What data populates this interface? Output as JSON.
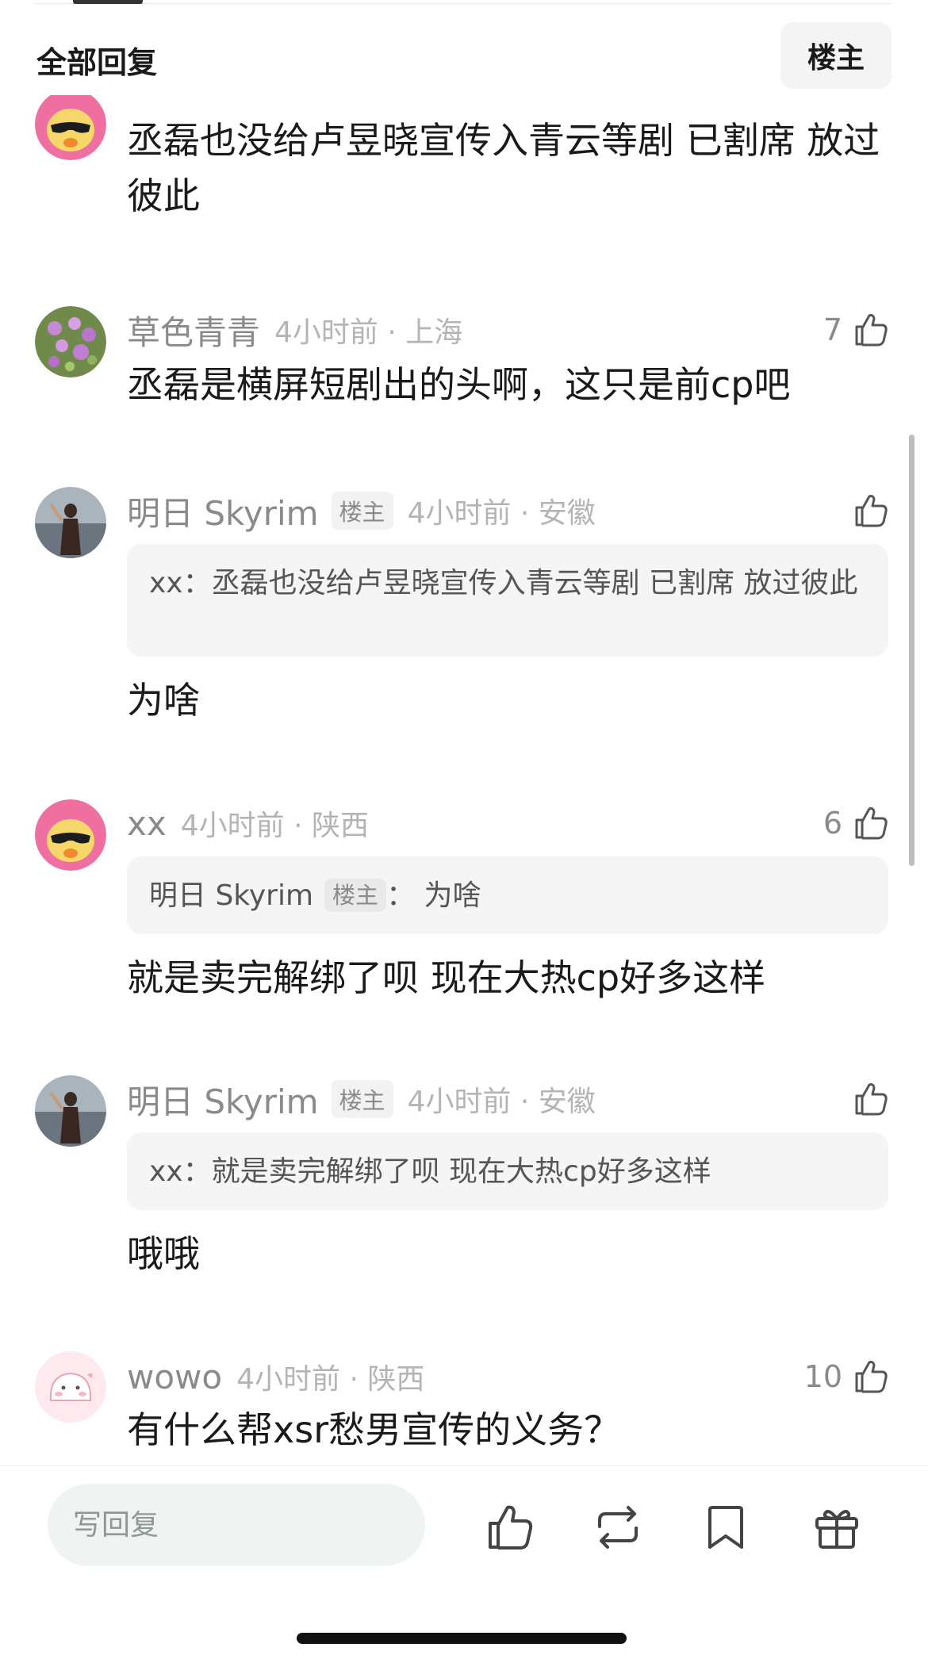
{
  "header": {
    "title": "全部回复",
    "op_filter_label": "楼主"
  },
  "comments": [
    {
      "avatar": "duck-sunglasses-avatar",
      "body": "丞磊也没给卢昱晓宣传入青云等剧 已割席 放过彼此"
    },
    {
      "username": "草色青青",
      "time": "4小时前 · 上海",
      "likes": "7",
      "avatar": "flowers-avatar",
      "body": "丞磊是横屏短剧出的头啊，这只是前cp吧"
    },
    {
      "username": "明日 Skyrim",
      "badge": "楼主",
      "time": "4小时前 · 安徽",
      "likes": "",
      "avatar": "beach-woman-avatar",
      "quote": "xx：丞磊也没给卢昱晓宣传入青云等剧 已割席 放过彼此",
      "body": "为啥"
    },
    {
      "username": "xx",
      "time": "4小时前 · 陕西",
      "likes": "6",
      "avatar": "duck-sunglasses-avatar",
      "quote_name": "明日 Skyrim",
      "quote_badge": "楼主",
      "quote_text": "： 为啥",
      "body": "就是卖完解绑了呗 现在大热cp好多这样"
    },
    {
      "username": "明日 Skyrim",
      "badge": "楼主",
      "time": "4小时前 · 安徽",
      "likes": "",
      "avatar": "beach-woman-avatar",
      "quote": "xx：就是卖完解绑了呗 现在大热cp好多这样",
      "body": "哦哦"
    },
    {
      "username": "wowo",
      "time": "4小时前 · 陕西",
      "likes": "10",
      "avatar": "pink-bunny-avatar",
      "body": "有什么帮xsr愁男宣传的义务？"
    }
  ],
  "bottom_bar": {
    "reply_placeholder": "写回复",
    "actions": [
      "like-icon",
      "repost-icon",
      "bookmark-icon",
      "gift-icon"
    ]
  },
  "colors": {
    "text": "#1a1a1a",
    "meta_gray": "#8a8a8a",
    "time_gray": "#b4b4b4",
    "quote_bg": "#f5f5f5",
    "reply_input_bg": "#eff4f2"
  }
}
